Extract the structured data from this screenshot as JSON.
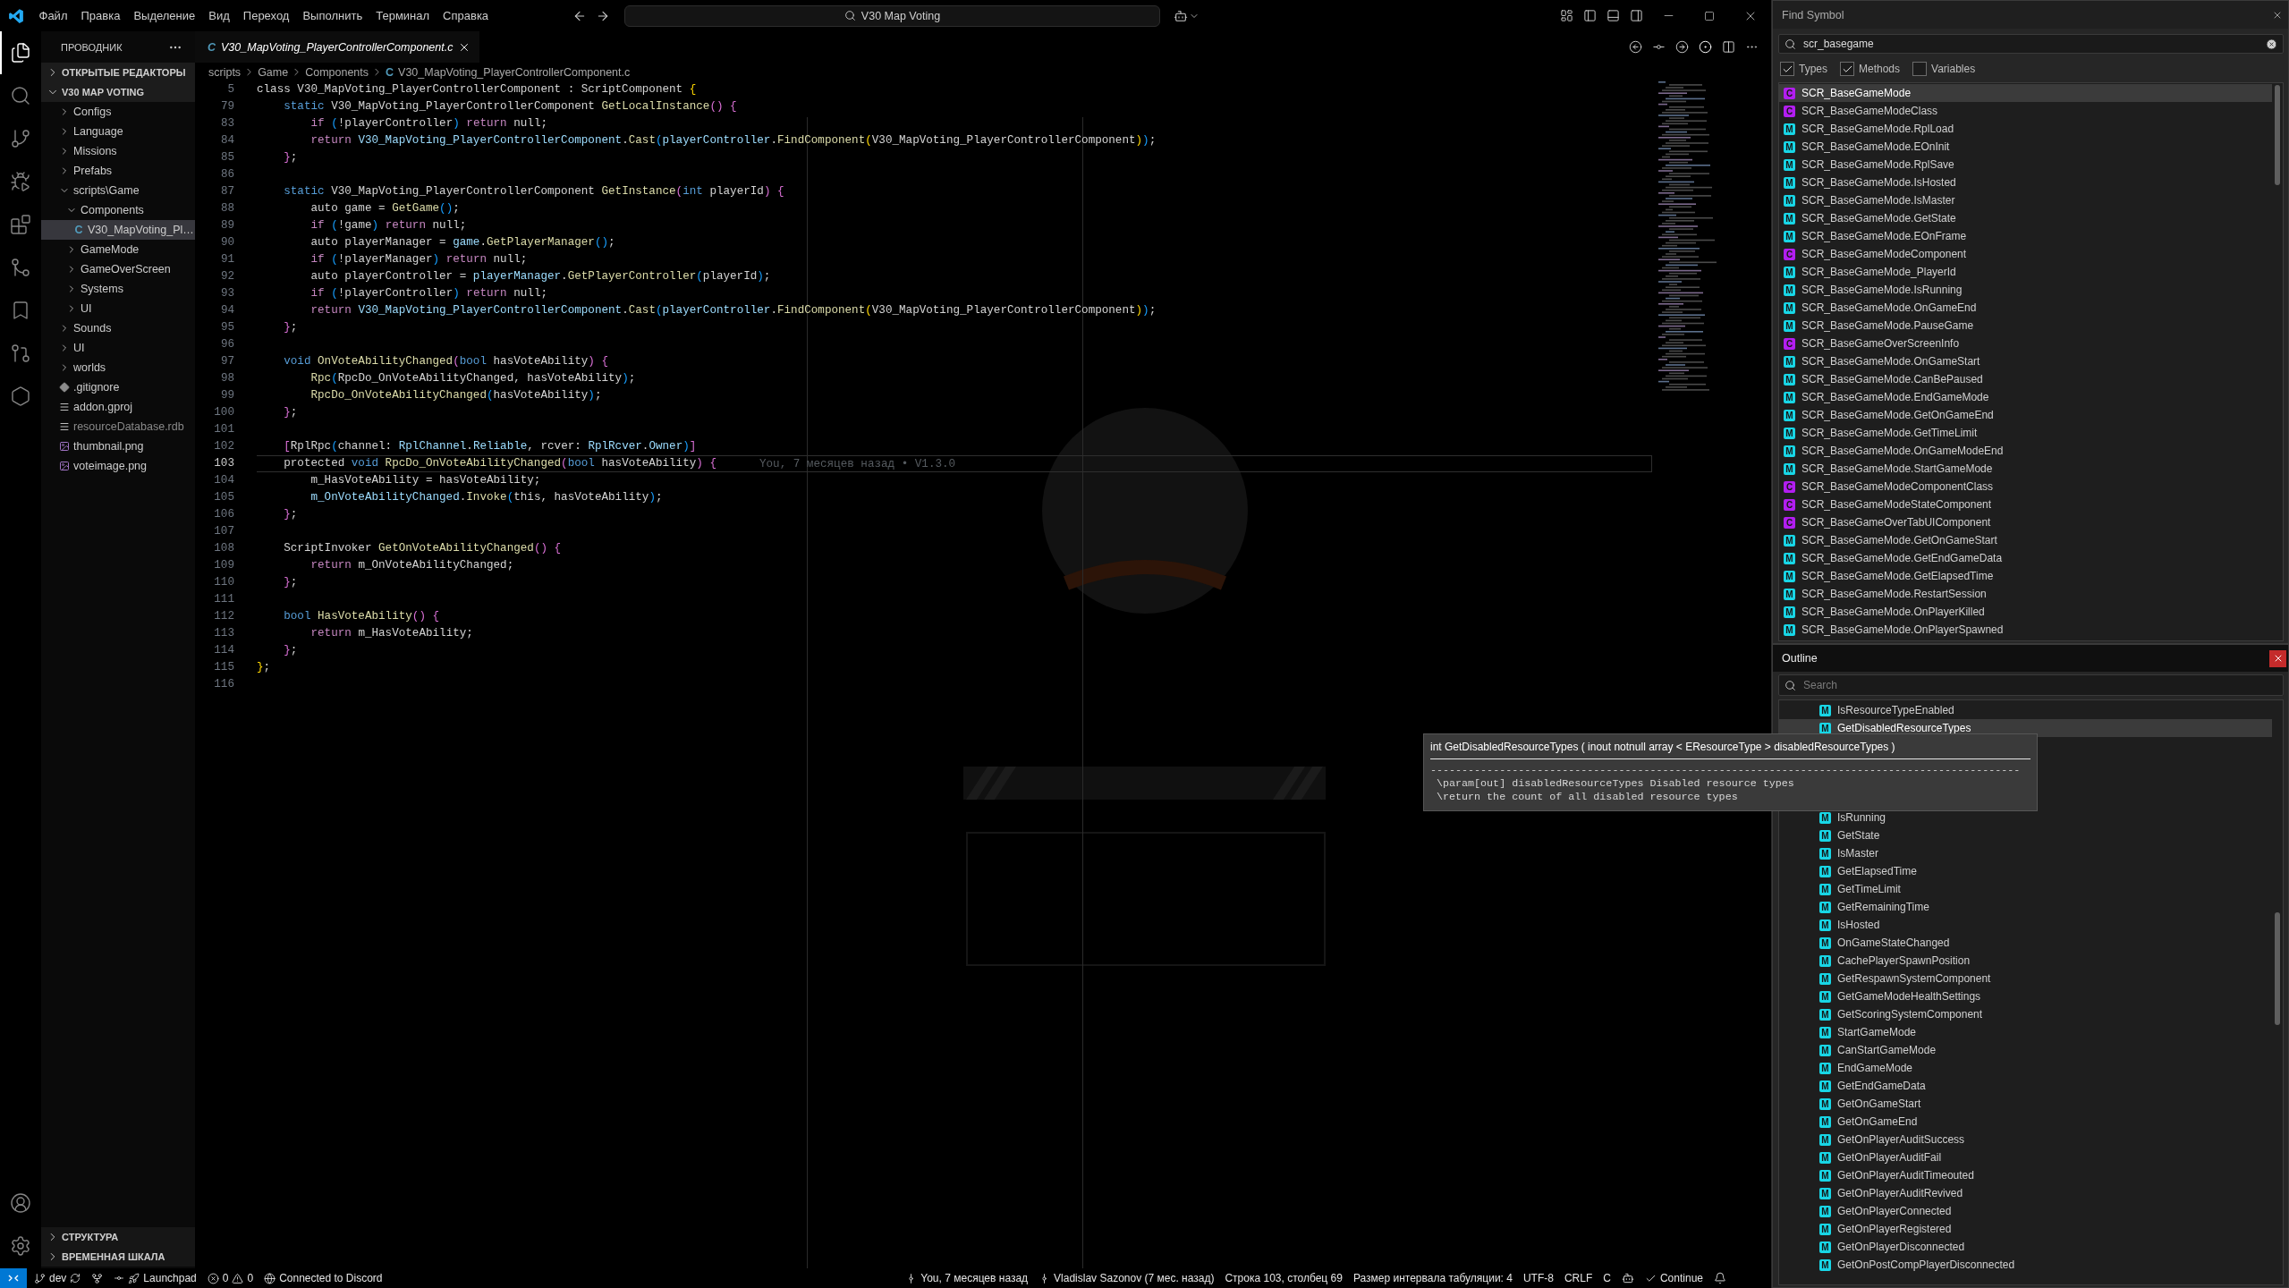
{
  "title_bar": {
    "menu": [
      "Файл",
      "Правка",
      "Выделение",
      "Вид",
      "Переход",
      "Выполнить",
      "Терминал",
      "Справка"
    ],
    "command_center": "V30 Map Voting"
  },
  "activity_bar": [
    {
      "kind": "explorer",
      "selected": true
    },
    {
      "kind": "search",
      "selected": false
    },
    {
      "kind": "source-control",
      "selected": false
    },
    {
      "kind": "run-debug",
      "selected": false
    },
    {
      "kind": "extensions",
      "selected": false
    },
    {
      "kind": "graph",
      "selected": false
    },
    {
      "kind": "bookmarks",
      "selected": false
    },
    {
      "kind": "history",
      "selected": false
    },
    {
      "kind": "hexagon",
      "selected": false
    }
  ],
  "sidebar": {
    "title": "ПРОВОДНИК",
    "sections": [
      {
        "label": "ОТКРЫТЫЕ РЕДАКТОРЫ",
        "expanded": false
      },
      {
        "label": "V30 MAP VOTING",
        "expanded": true,
        "items": [
          {
            "kind": "folder",
            "label": "Configs",
            "expanded": false,
            "selected": false,
            "dimmed": false
          },
          {
            "kind": "folder",
            "label": "Language",
            "expanded": false,
            "selected": false,
            "dimmed": false
          },
          {
            "kind": "folder",
            "label": "Missions",
            "expanded": false,
            "selected": false,
            "dimmed": false
          },
          {
            "kind": "folder",
            "label": "Prefabs",
            "expanded": false,
            "selected": false,
            "dimmed": false
          },
          {
            "kind": "folder",
            "label": "scripts\\Game",
            "expanded": true,
            "selected": false,
            "dimmed": false,
            "children": [
              {
                "kind": "folder",
                "label": "Components",
                "expanded": true,
                "selected": false,
                "dimmed": false,
                "children": [
                  {
                    "kind": "c-file",
                    "badge": "C",
                    "label": "V30_MapVoting_Pl…",
                    "selected": true,
                    "dimmed": false
                  }
                ]
              },
              {
                "kind": "folder",
                "label": "GameMode",
                "expanded": false,
                "selected": false,
                "dimmed": false
              },
              {
                "kind": "folder",
                "label": "GameOverScreen",
                "expanded": false,
                "selected": false,
                "dimmed": false
              },
              {
                "kind": "folder",
                "label": "Systems",
                "expanded": false,
                "selected": false,
                "dimmed": false
              },
              {
                "kind": "folder",
                "label": "UI",
                "expanded": false,
                "selected": false,
                "dimmed": false
              }
            ]
          },
          {
            "kind": "folder",
            "label": "Sounds",
            "expanded": false,
            "selected": false,
            "dimmed": false
          },
          {
            "kind": "folder",
            "label": "UI",
            "expanded": false,
            "selected": false,
            "dimmed": false
          },
          {
            "kind": "folder",
            "label": "worlds",
            "expanded": false,
            "selected": false,
            "dimmed": false
          },
          {
            "kind": "git-file",
            "label": ".gitignore",
            "selected": false,
            "dimmed": false
          },
          {
            "kind": "text-file",
            "label": "addon.gproj",
            "selected": false,
            "dimmed": false
          },
          {
            "kind": "text-file",
            "label": "resourceDatabase.rdb",
            "selected": false,
            "dimmed": true
          },
          {
            "kind": "image-file",
            "label": "thumbnail.png",
            "selected": false,
            "dimmed": false
          },
          {
            "kind": "image-file",
            "label": "voteimage.png",
            "selected": false,
            "dimmed": false
          }
        ]
      }
    ],
    "bottom_sections": [
      {
        "label": "СТРУКТУРА",
        "expanded": false
      },
      {
        "label": "ВРЕМЕННАЯ ШКАЛА",
        "expanded": false
      }
    ]
  },
  "editor": {
    "tabs": [
      {
        "badge": "C",
        "label": "V30_MapVoting_PlayerControllerComponent.c",
        "selected": true,
        "preview": true
      }
    ],
    "breadcrumbs": [
      {
        "label": "scripts"
      },
      {
        "label": "Game"
      },
      {
        "label": "Components"
      },
      {
        "badge": "C",
        "label": "V30_MapVoting_PlayerControllerComponent.c"
      }
    ],
    "lines": [
      {
        "number": "5",
        "current": false,
        "tokens": [
          {
            "kind": "plain",
            "text": "class V30_MapVoting_PlayerControllerComponent : ScriptComponent "
          },
          {
            "kind": "bracket1",
            "text": "{"
          }
        ],
        "children": [
          {
            "number": "79",
            "current": false,
            "tokens": [
              {
                "kind": "keyword",
                "text": "static"
              },
              {
                "kind": "plain",
                "text": " V30_MapVoting_PlayerControllerComponent "
              },
              {
                "kind": "function",
                "text": "GetLocalInstance"
              },
              {
                "kind": "bracket2",
                "text": "()"
              },
              {
                "kind": "bracket2",
                "text": " {"
              }
            ],
            "children": [
              {
                "number": "83",
                "current": false,
                "tokens": [
                  {
                    "kind": "control",
                    "text": "if"
                  },
                  {
                    "kind": "bracket3",
                    "text": " ("
                  },
                  {
                    "kind": "plain",
                    "text": "!playerController"
                  },
                  {
                    "kind": "bracket3",
                    "text": ")"
                  },
                  {
                    "kind": "control",
                    "text": " return"
                  },
                  {
                    "kind": "plain",
                    "text": " null;"
                  }
                ]
              },
              {
                "number": "84",
                "current": false,
                "tokens": [
                  {
                    "kind": "control",
                    "text": "return"
                  },
                  {
                    "kind": "variable",
                    "text": " V30_MapVoting_PlayerControllerComponent"
                  },
                  {
                    "kind": "plain",
                    "text": "."
                  },
                  {
                    "kind": "function",
                    "text": "Cast"
                  },
                  {
                    "kind": "bracket3",
                    "text": "("
                  },
                  {
                    "kind": "variable",
                    "text": "playerController"
                  },
                  {
                    "kind": "plain",
                    "text": "."
                  },
                  {
                    "kind": "function",
                    "text": "FindComponent"
                  },
                  {
                    "kind": "bracket1",
                    "text": "("
                  },
                  {
                    "kind": "plain",
                    "text": "V30_MapVoting_PlayerControllerComponent"
                  },
                  {
                    "kind": "bracket1",
                    "text": ")"
                  },
                  {
                    "kind": "bracket3",
                    "text": ")"
                  },
                  {
                    "kind": "plain",
                    "text": ";"
                  }
                ]
              }
            ]
          },
          {
            "number": "85",
            "current": false,
            "tokens": [
              {
                "kind": "bracket2",
                "text": "}"
              },
              {
                "kind": "plain",
                "text": ";"
              }
            ]
          },
          {
            "number": "86",
            "current": false
          },
          {
            "number": "87",
            "current": false,
            "tokens": [
              {
                "kind": "keyword",
                "text": "static"
              },
              {
                "kind": "plain",
                "text": " V30_MapVoting_PlayerControllerComponent "
              },
              {
                "kind": "function",
                "text": "GetInstance"
              },
              {
                "kind": "bracket2",
                "text": "("
              },
              {
                "kind": "keyword",
                "text": "int"
              },
              {
                "kind": "plain",
                "text": " playerId"
              },
              {
                "kind": "bracket2",
                "text": ")"
              },
              {
                "kind": "bracket2",
                "text": " {"
              }
            ],
            "children": [
              {
                "number": "88",
                "current": false,
                "tokens": [
                  {
                    "kind": "plain",
                    "text": "auto game = "
                  },
                  {
                    "kind": "function",
                    "text": "GetGame"
                  },
                  {
                    "kind": "bracket3",
                    "text": "()"
                  },
                  {
                    "kind": "plain",
                    "text": ";"
                  }
                ]
              },
              {
                "number": "89",
                "current": false,
                "tokens": [
                  {
                    "kind": "control",
                    "text": "if"
                  },
                  {
                    "kind": "bracket3",
                    "text": " ("
                  },
                  {
                    "kind": "plain",
                    "text": "!game"
                  },
                  {
                    "kind": "bracket3",
                    "text": ")"
                  },
                  {
                    "kind": "control",
                    "text": " return"
                  },
                  {
                    "kind": "plain",
                    "text": " null;"
                  }
                ]
              },
              {
                "number": "90",
                "current": false,
                "tokens": [
                  {
                    "kind": "plain",
                    "text": "auto playerManager = "
                  },
                  {
                    "kind": "variable",
                    "text": "game"
                  },
                  {
                    "kind": "plain",
                    "text": "."
                  },
                  {
                    "kind": "function",
                    "text": "GetPlayerManager"
                  },
                  {
                    "kind": "bracket3",
                    "text": "()"
                  },
                  {
                    "kind": "plain",
                    "text": ";"
                  }
                ]
              },
              {
                "number": "91",
                "current": false,
                "tokens": [
                  {
                    "kind": "control",
                    "text": "if"
                  },
                  {
                    "kind": "bracket3",
                    "text": " ("
                  },
                  {
                    "kind": "plain",
                    "text": "!playerManager"
                  },
                  {
                    "kind": "bracket3",
                    "text": ")"
                  },
                  {
                    "kind": "control",
                    "text": " return"
                  },
                  {
                    "kind": "plain",
                    "text": " null;"
                  }
                ]
              },
              {
                "number": "92",
                "current": false,
                "tokens": [
                  {
                    "kind": "plain",
                    "text": "auto playerController = "
                  },
                  {
                    "kind": "variable",
                    "text": "playerManager"
                  },
                  {
                    "kind": "plain",
                    "text": "."
                  },
                  {
                    "kind": "function",
                    "text": "GetPlayerController"
                  },
                  {
                    "kind": "bracket3",
                    "text": "("
                  },
                  {
                    "kind": "plain",
                    "text": "playerId"
                  },
                  {
                    "kind": "bracket3",
                    "text": ")"
                  },
                  {
                    "kind": "plain",
                    "text": ";"
                  }
                ]
              },
              {
                "number": "93",
                "current": false,
                "tokens": [
                  {
                    "kind": "control",
                    "text": "if"
                  },
                  {
                    "kind": "bracket3",
                    "text": " ("
                  },
                  {
                    "kind": "plain",
                    "text": "!playerController"
                  },
                  {
                    "kind": "bracket3",
                    "text": ")"
                  },
                  {
                    "kind": "control",
                    "text": " return"
                  },
                  {
                    "kind": "plain",
                    "text": " null;"
                  }
                ]
              },
              {
                "number": "94",
                "current": false,
                "tokens": [
                  {
                    "kind": "control",
                    "text": "return"
                  },
                  {
                    "kind": "variable",
                    "text": " V30_MapVoting_PlayerControllerComponent"
                  },
                  {
                    "kind": "plain",
                    "text": "."
                  },
                  {
                    "kind": "function",
                    "text": "Cast"
                  },
                  {
                    "kind": "bracket3",
                    "text": "("
                  },
                  {
                    "kind": "variable",
                    "text": "playerController"
                  },
                  {
                    "kind": "plain",
                    "text": "."
                  },
                  {
                    "kind": "function",
                    "text": "FindComponent"
                  },
                  {
                    "kind": "bracket1",
                    "text": "("
                  },
                  {
                    "kind": "plain",
                    "text": "V30_MapVoting_PlayerControllerComponent"
                  },
                  {
                    "kind": "bracket1",
                    "text": ")"
                  },
                  {
                    "kind": "bracket3",
                    "text": ")"
                  },
                  {
                    "kind": "plain",
                    "text": ";"
                  }
                ]
              }
            ]
          },
          {
            "number": "95",
            "current": false,
            "tokens": [
              {
                "kind": "bracket2",
                "text": "}"
              },
              {
                "kind": "plain",
                "text": ";"
              }
            ]
          },
          {
            "number": "96",
            "current": false
          },
          {
            "number": "97",
            "current": false,
            "tokens": [
              {
                "kind": "keyword",
                "text": "void"
              },
              {
                "kind": "function",
                "text": " OnVoteAbilityChanged"
              },
              {
                "kind": "bracket2",
                "text": "("
              },
              {
                "kind": "keyword",
                "text": "bool"
              },
              {
                "kind": "plain",
                "text": " hasVoteAbility"
              },
              {
                "kind": "bracket2",
                "text": ")"
              },
              {
                "kind": "bracket2",
                "text": " {"
              }
            ],
            "children": [
              {
                "number": "98",
                "current": false,
                "tokens": [
                  {
                    "kind": "function",
                    "text": "Rpc"
                  },
                  {
                    "kind": "bracket3",
                    "text": "("
                  },
                  {
                    "kind": "plain",
                    "text": "RpcDo_OnVoteAbilityChanged, hasVoteAbility"
                  },
                  {
                    "kind": "bracket3",
                    "text": ")"
                  },
                  {
                    "kind": "plain",
                    "text": ";"
                  }
                ]
              },
              {
                "number": "99",
                "current": false,
                "tokens": [
                  {
                    "kind": "function",
                    "text": "RpcDo_OnVoteAbilityChanged"
                  },
                  {
                    "kind": "bracket3",
                    "text": "("
                  },
                  {
                    "kind": "plain",
                    "text": "hasVoteAbility"
                  },
                  {
                    "kind": "bracket3",
                    "text": ")"
                  },
                  {
                    "kind": "plain",
                    "text": ";"
                  }
                ]
              }
            ]
          },
          {
            "number": "100",
            "current": false,
            "tokens": [
              {
                "kind": "bracket2",
                "text": "}"
              },
              {
                "kind": "plain",
                "text": ";"
              }
            ]
          },
          {
            "number": "101",
            "current": false
          },
          {
            "number": "102",
            "current": false,
            "tokens": [
              {
                "kind": "bracket2",
                "text": "["
              },
              {
                "kind": "plain",
                "text": "RplRpc"
              },
              {
                "kind": "bracket3",
                "text": "("
              },
              {
                "kind": "plain",
                "text": "channel: "
              },
              {
                "kind": "variable",
                "text": "RplChannel"
              },
              {
                "kind": "plain",
                "text": "."
              },
              {
                "kind": "variable",
                "text": "Reliable"
              },
              {
                "kind": "plain",
                "text": ", rcver: "
              },
              {
                "kind": "variable",
                "text": "RplRcver"
              },
              {
                "kind": "plain",
                "text": "."
              },
              {
                "kind": "variable",
                "text": "Owner"
              },
              {
                "kind": "bracket3",
                "text": ")"
              },
              {
                "kind": "bracket2",
                "text": "]"
              }
            ]
          },
          {
            "number": "103",
            "current": true,
            "blame": "You, 7 месяцев назад • V1.3.0",
            "tokens": [
              {
                "kind": "plain",
                "text": "protected "
              },
              {
                "kind": "keyword",
                "text": "void"
              },
              {
                "kind": "function",
                "text": " RpcDo_OnVoteAbilityChanged"
              },
              {
                "kind": "bracket2",
                "text": "("
              },
              {
                "kind": "keyword",
                "text": "bool"
              },
              {
                "kind": "plain",
                "text": " hasVoteAbility"
              },
              {
                "kind": "bracket2",
                "text": ")"
              },
              {
                "kind": "bracket2",
                "text": " {"
              }
            ],
            "children": [
              {
                "number": "104",
                "current": false,
                "tokens": [
                  {
                    "kind": "plain",
                    "text": "m_HasVoteAbility = hasVoteAbility;"
                  }
                ]
              },
              {
                "number": "105",
                "current": false,
                "tokens": [
                  {
                    "kind": "variable",
                    "text": "m_OnVoteAbilityChanged"
                  },
                  {
                    "kind": "plain",
                    "text": "."
                  },
                  {
                    "kind": "function",
                    "text": "Invoke"
                  },
                  {
                    "kind": "bracket3",
                    "text": "("
                  },
                  {
                    "kind": "plain",
                    "text": "this, hasVoteAbility"
                  },
                  {
                    "kind": "bracket3",
                    "text": ")"
                  },
                  {
                    "kind": "plain",
                    "text": ";"
                  }
                ]
              }
            ]
          },
          {
            "number": "106",
            "current": false,
            "tokens": [
              {
                "kind": "bracket2",
                "text": "}"
              },
              {
                "kind": "plain",
                "text": ";"
              }
            ]
          },
          {
            "number": "107",
            "current": false
          },
          {
            "number": "108",
            "current": false,
            "tokens": [
              {
                "kind": "plain",
                "text": "ScriptInvoker "
              },
              {
                "kind": "function",
                "text": "GetOnVoteAbilityChanged"
              },
              {
                "kind": "bracket2",
                "text": "()"
              },
              {
                "kind": "bracket2",
                "text": " {"
              }
            ],
            "children": [
              {
                "number": "109",
                "current": false,
                "tokens": [
                  {
                    "kind": "control",
                    "text": "return"
                  },
                  {
                    "kind": "plain",
                    "text": " m_OnVoteAbilityChanged;"
                  }
                ]
              }
            ]
          },
          {
            "number": "110",
            "current": false,
            "tokens": [
              {
                "kind": "bracket2",
                "text": "}"
              },
              {
                "kind": "plain",
                "text": ";"
              }
            ]
          },
          {
            "number": "111",
            "current": false
          },
          {
            "number": "112",
            "current": false,
            "tokens": [
              {
                "kind": "keyword",
                "text": "bool"
              },
              {
                "kind": "function",
                "text": " HasVoteAbility"
              },
              {
                "kind": "bracket2",
                "text": "()"
              },
              {
                "kind": "bracket2",
                "text": " {"
              }
            ],
            "children": [
              {
                "number": "113",
                "current": false,
                "tokens": [
                  {
                    "kind": "control",
                    "text": "return"
                  },
                  {
                    "kind": "plain",
                    "text": " m_HasVoteAbility;"
                  }
                ]
              }
            ]
          },
          {
            "number": "114",
            "current": false,
            "tokens": [
              {
                "kind": "bracket2",
                "text": "}"
              },
              {
                "kind": "plain",
                "text": ";"
              }
            ]
          }
        ]
      },
      {
        "number": "115",
        "current": false,
        "tokens": [
          {
            "kind": "bracket1",
            "text": "}"
          },
          {
            "kind": "plain",
            "text": ";"
          }
        ]
      },
      {
        "number": "116",
        "current": false
      }
    ]
  },
  "find_symbol": {
    "title": "Find Symbol",
    "query": "scr_basegame",
    "filters": [
      {
        "label": "Types",
        "checked": true
      },
      {
        "label": "Methods",
        "checked": true
      },
      {
        "label": "Variables",
        "checked": false
      }
    ],
    "results": [
      {
        "kind": "class",
        "badge": "C",
        "label": "SCR_BaseGameMode",
        "selected": true
      },
      {
        "kind": "class",
        "badge": "C",
        "label": "SCR_BaseGameModeClass",
        "selected": false
      },
      {
        "kind": "method",
        "badge": "M",
        "label": "SCR_BaseGameMode.RplLoad",
        "selected": false
      },
      {
        "kind": "method",
        "badge": "M",
        "label": "SCR_BaseGameMode.EOnInit",
        "selected": false
      },
      {
        "kind": "method",
        "badge": "M",
        "label": "SCR_BaseGameMode.RplSave",
        "selected": false
      },
      {
        "kind": "method",
        "badge": "M",
        "label": "SCR_BaseGameMode.IsHosted",
        "selected": false
      },
      {
        "kind": "method",
        "badge": "M",
        "label": "SCR_BaseGameMode.IsMaster",
        "selected": false
      },
      {
        "kind": "method",
        "badge": "M",
        "label": "SCR_BaseGameMode.GetState",
        "selected": false
      },
      {
        "kind": "method",
        "badge": "M",
        "label": "SCR_BaseGameMode.EOnFrame",
        "selected": false
      },
      {
        "kind": "class",
        "badge": "C",
        "label": "SCR_BaseGameModeComponent",
        "selected": false
      },
      {
        "kind": "method",
        "badge": "M",
        "label": "SCR_BaseGameMode_PlayerId",
        "selected": false
      },
      {
        "kind": "method",
        "badge": "M",
        "label": "SCR_BaseGameMode.IsRunning",
        "selected": false
      },
      {
        "kind": "method",
        "badge": "M",
        "label": "SCR_BaseGameMode.OnGameEnd",
        "selected": false
      },
      {
        "kind": "method",
        "badge": "M",
        "label": "SCR_BaseGameMode.PauseGame",
        "selected": false
      },
      {
        "kind": "class",
        "badge": "C",
        "label": "SCR_BaseGameOverScreenInfo",
        "selected": false
      },
      {
        "kind": "method",
        "badge": "M",
        "label": "SCR_BaseGameMode.OnGameStart",
        "selected": false
      },
      {
        "kind": "method",
        "badge": "M",
        "label": "SCR_BaseGameMode.CanBePaused",
        "selected": false
      },
      {
        "kind": "method",
        "badge": "M",
        "label": "SCR_BaseGameMode.EndGameMode",
        "selected": false
      },
      {
        "kind": "method",
        "badge": "M",
        "label": "SCR_BaseGameMode.GetOnGameEnd",
        "selected": false
      },
      {
        "kind": "method",
        "badge": "M",
        "label": "SCR_BaseGameMode.GetTimeLimit",
        "selected": false
      },
      {
        "kind": "method",
        "badge": "M",
        "label": "SCR_BaseGameMode.OnGameModeEnd",
        "selected": false
      },
      {
        "kind": "method",
        "badge": "M",
        "label": "SCR_BaseGameMode.StartGameMode",
        "selected": false
      },
      {
        "kind": "class",
        "badge": "C",
        "label": "SCR_BaseGameModeComponentClass",
        "selected": false
      },
      {
        "kind": "class",
        "badge": "C",
        "label": "SCR_BaseGameModeStateComponent",
        "selected": false
      },
      {
        "kind": "class",
        "badge": "C",
        "label": "SCR_BaseGameOverTabUIComponent",
        "selected": false
      },
      {
        "kind": "method",
        "badge": "M",
        "label": "SCR_BaseGameMode.GetOnGameStart",
        "selected": false
      },
      {
        "kind": "method",
        "badge": "M",
        "label": "SCR_BaseGameMode.GetEndGameData",
        "selected": false
      },
      {
        "kind": "method",
        "badge": "M",
        "label": "SCR_BaseGameMode.GetElapsedTime",
        "selected": false
      },
      {
        "kind": "method",
        "badge": "M",
        "label": "SCR_BaseGameMode.RestartSession",
        "selected": false
      },
      {
        "kind": "method",
        "badge": "M",
        "label": "SCR_BaseGameMode.OnPlayerKilled",
        "selected": false
      },
      {
        "kind": "method",
        "badge": "M",
        "label": "SCR_BaseGameMode.OnPlayerSpawned",
        "selected": false
      }
    ]
  },
  "outline": {
    "title": "Outline",
    "search": {
      "placeholder": "Search"
    },
    "items": [
      {
        "kind": "method",
        "badge": "M",
        "label": "IsResourceTypeEnabled",
        "selected": false
      },
      {
        "kind": "method",
        "badge": "M",
        "label": "GetDisabledResourceTypes",
        "selected": true
      }
    ],
    "items_below_tooltip": [
      {
        "kind": "method",
        "badge": "M",
        "label": "IsRunning",
        "selected": false
      },
      {
        "kind": "method",
        "badge": "M",
        "label": "GetState",
        "selected": false
      },
      {
        "kind": "method",
        "badge": "M",
        "label": "IsMaster",
        "selected": false
      },
      {
        "kind": "method",
        "badge": "M",
        "label": "GetElapsedTime",
        "selected": false
      },
      {
        "kind": "method",
        "badge": "M",
        "label": "GetTimeLimit",
        "selected": false
      },
      {
        "kind": "method",
        "badge": "M",
        "label": "GetRemainingTime",
        "selected": false
      },
      {
        "kind": "method",
        "badge": "M",
        "label": "IsHosted",
        "selected": false
      },
      {
        "kind": "method",
        "badge": "M",
        "label": "OnGameStateChanged",
        "selected": false
      },
      {
        "kind": "method",
        "badge": "M",
        "label": "CachePlayerSpawnPosition",
        "selected": false
      },
      {
        "kind": "method",
        "badge": "M",
        "label": "GetRespawnSystemComponent",
        "selected": false
      },
      {
        "kind": "method",
        "badge": "M",
        "label": "GetGameModeHealthSettings",
        "selected": false
      },
      {
        "kind": "method",
        "badge": "M",
        "label": "GetScoringSystemComponent",
        "selected": false
      },
      {
        "kind": "method",
        "badge": "M",
        "label": "StartGameMode",
        "selected": false
      },
      {
        "kind": "method",
        "badge": "M",
        "label": "CanStartGameMode",
        "selected": false
      },
      {
        "kind": "method",
        "badge": "M",
        "label": "EndGameMode",
        "selected": false
      },
      {
        "kind": "method",
        "badge": "M",
        "label": "GetEndGameData",
        "selected": false
      },
      {
        "kind": "method",
        "badge": "M",
        "label": "GetOnGameStart",
        "selected": false
      },
      {
        "kind": "method",
        "badge": "M",
        "label": "GetOnGameEnd",
        "selected": false
      },
      {
        "kind": "method",
        "badge": "M",
        "label": "GetOnPlayerAuditSuccess",
        "selected": false
      },
      {
        "kind": "method",
        "badge": "M",
        "label": "GetOnPlayerAuditFail",
        "selected": false
      },
      {
        "kind": "method",
        "badge": "M",
        "label": "GetOnPlayerAuditTimeouted",
        "selected": false
      },
      {
        "kind": "method",
        "badge": "M",
        "label": "GetOnPlayerAuditRevived",
        "selected": false
      },
      {
        "kind": "method",
        "badge": "M",
        "label": "GetOnPlayerConnected",
        "selected": false
      },
      {
        "kind": "method",
        "badge": "M",
        "label": "GetOnPlayerRegistered",
        "selected": false
      },
      {
        "kind": "method",
        "badge": "M",
        "label": "GetOnPlayerDisconnected",
        "selected": false
      },
      {
        "kind": "method",
        "badge": "M",
        "label": "GetOnPostCompPlayerDisconnected",
        "selected": false
      }
    ]
  },
  "hover_tooltip": {
    "signature": "int GetDisabledResourceTypes ( inout notnull array < EResourceType > disabledResourceTypes )",
    "separator": "----------------------------------------------------------------------------------------------",
    "doc": [
      "\\param[out] disabledResourceTypes Disabled resource types",
      "\\return the count of all disabled resource types"
    ]
  },
  "status_bar": {
    "left": [
      {
        "kind": "branch",
        "text": "dev"
      },
      {
        "kind": "launchpad",
        "text": "Launchpad"
      },
      {
        "kind": "problems",
        "errors": "0",
        "warnings": "0"
      },
      {
        "kind": "discord",
        "text": "Connected to Discord"
      }
    ],
    "right": [
      {
        "kind": "blame",
        "text": "You, 7 месяцев назад"
      },
      {
        "kind": "author",
        "text": "Vladislav Sazonov (7 мес. назад)"
      },
      {
        "kind": "plain",
        "text": "Строка 103, столбец 69"
      },
      {
        "kind": "plain",
        "text": "Размер интервала табуляции: 4"
      },
      {
        "kind": "plain",
        "text": "UTF-8"
      },
      {
        "kind": "plain",
        "text": "CRLF"
      },
      {
        "kind": "plain",
        "text": "C"
      },
      {
        "kind": "copilot"
      },
      {
        "kind": "continue",
        "text": "Continue"
      },
      {
        "kind": "bell"
      }
    ]
  }
}
